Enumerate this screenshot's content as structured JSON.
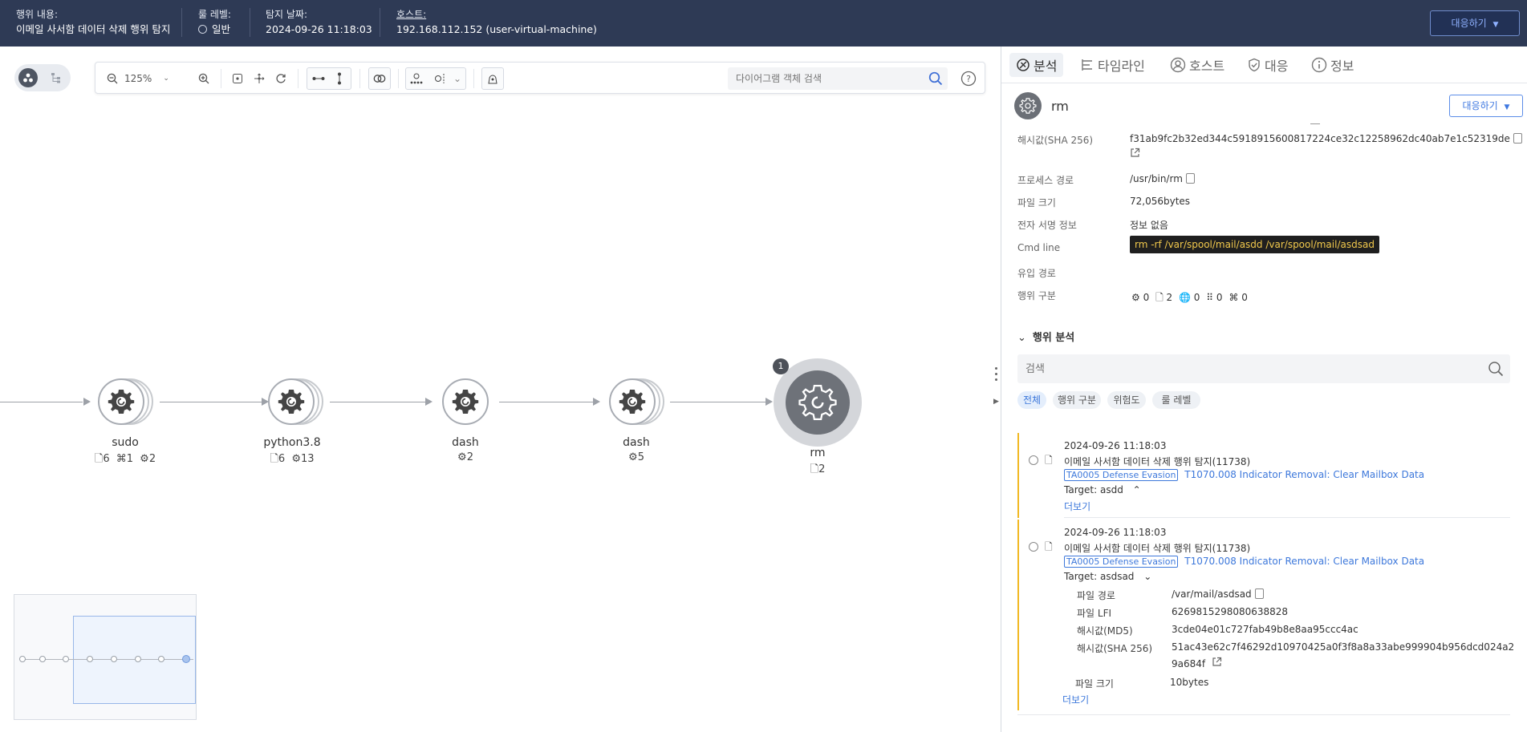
{
  "topbar": {
    "action_label": "행위 내용:",
    "action_value": "이메일 사서함 데이터 삭제 행위 탐지",
    "rule_level_label": "룰 레벨:",
    "rule_level_value": "일반",
    "detect_date_label": "탐지 날짜:",
    "detect_date_value": "2024-09-26 11:18:03",
    "host_label": "호스트:",
    "host_value": "192.168.112.152 (user-virtual-machine)",
    "respond_label": "대응하기"
  },
  "toolbar": {
    "zoom_value": "125%",
    "search_placeholder": "다이어그램 객체 검색"
  },
  "graph": {
    "nodes": [
      {
        "name": "sudo",
        "stat_file": "6",
        "stat_reg": "1",
        "stat_proc": "2"
      },
      {
        "name": "python3.8",
        "stat_file": "6",
        "stat_proc": "13"
      },
      {
        "name": "dash",
        "stat_proc": "2"
      },
      {
        "name": "dash",
        "stat_proc": "5"
      },
      {
        "name": "rm",
        "stat_file": "2",
        "badge": "1"
      }
    ]
  },
  "panel": {
    "tabs": [
      {
        "label": "분석"
      },
      {
        "label": "타임라인"
      },
      {
        "label": "호스트"
      },
      {
        "label": "대응"
      },
      {
        "label": "정보"
      }
    ],
    "process_name": "rm",
    "respond_label": "대응하기",
    "info": [
      {
        "label": "해시값(SHA 256)",
        "value": "f31ab9fc2b32ed344c5918915600817224ce32c12258962dc40ab7e1c52319de"
      },
      {
        "label": "프로세스 경로",
        "value": "/usr/bin/rm"
      },
      {
        "label": "파일 크기",
        "value": "72,056bytes"
      },
      {
        "label": "전자 서명 정보",
        "value": "정보 없음"
      },
      {
        "label": "Cmd line",
        "value": "rm -rf /var/spool/mail/asdd /var/spool/mail/asdsad"
      },
      {
        "label": "유입 경로",
        "value": ""
      },
      {
        "label": "행위 구분",
        "value": ""
      }
    ],
    "behavior_counts": {
      "proc": "0",
      "file": "2",
      "net": "0",
      "reg": "0",
      "other": "0"
    },
    "analysis_title": "행위 분석",
    "search_placeholder": "검색",
    "filters": [
      "전체",
      "행위 구분",
      "위험도",
      "룰 레벨"
    ],
    "events": [
      {
        "time": "2024-09-26 11:18:03",
        "title": "이메일 사서함 데이터 삭제 행위 탐지(11738)",
        "tactic_id": "TA0005",
        "tactic_name": "Defense Evasion",
        "technique": "T1070.008 Indicator Removal: Clear Mailbox Data",
        "target": "Target: asdd",
        "more": "더보기"
      },
      {
        "time": "2024-09-26 11:18:03",
        "title": "이메일 사서함 데이터 삭제 행위 탐지(11738)",
        "tactic_id": "TA0005",
        "tactic_name": "Defense Evasion",
        "technique": "T1070.008 Indicator Removal: Clear Mailbox Data",
        "target": "Target: asdsad",
        "details": [
          {
            "label": "파일 경로",
            "value": "/var/mail/asdsad"
          },
          {
            "label": "파일 LFI",
            "value": "6269815298080638828"
          },
          {
            "label": "해시값(MD5)",
            "value": "3cde04e01c727fab49b8e8aa95ccc4ac"
          },
          {
            "label": "해시값(SHA 256)",
            "value": "51ac43e62c7f46292d10970425a0f3f8a8a33abe999904b956dcd024a2"
          },
          {
            "label": "",
            "value": "9a684f"
          },
          {
            "label": "파일 크기",
            "value": "10bytes"
          }
        ],
        "more": "더보기"
      }
    ]
  }
}
